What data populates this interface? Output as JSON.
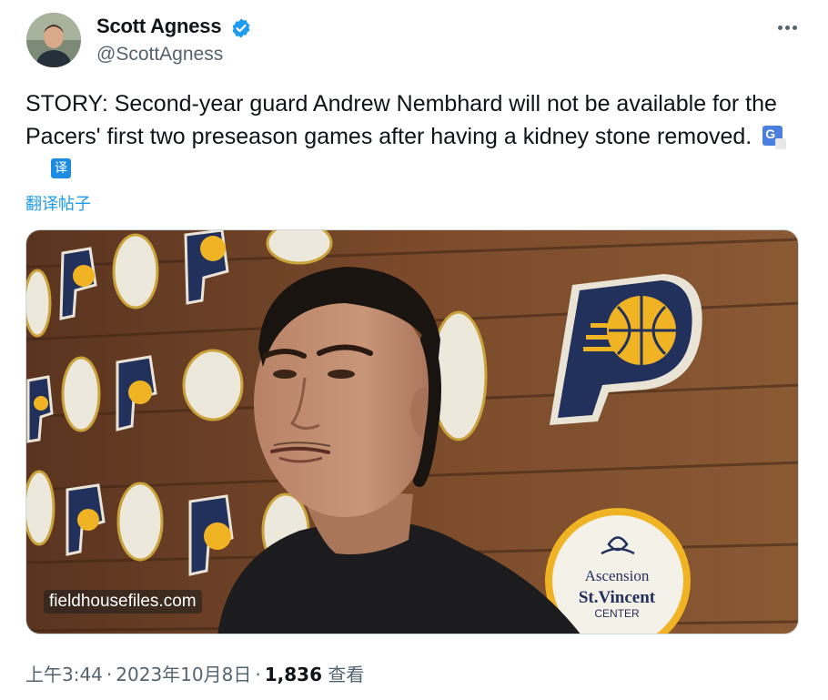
{
  "author": {
    "name": "Scott Agness",
    "handle": "@ScottAgness",
    "verified": true,
    "verified_color": "#1d9bf0"
  },
  "icons": {
    "avatar": "avatar",
    "verified": "verified-badge-icon",
    "more": "more-options-icon",
    "google_translate": "google-translate-icon",
    "translate": "translate-icon"
  },
  "tweet": {
    "text": "STORY: Second-year guard Andrew Nembhard will not be available for the Pacers' first two preseason games after having a kidney stone removed.",
    "translate_glyph": "译",
    "translate_label": "翻译帖子"
  },
  "media": {
    "watermark": "fieldhousefiles.com",
    "sign_lines": [
      "Ascension",
      "St.Vincent",
      "CENTER"
    ]
  },
  "meta": {
    "time": "上午3:44",
    "date": "2023年10月8日",
    "views_count": "1,836",
    "views_label": "查看",
    "separator": "·"
  }
}
